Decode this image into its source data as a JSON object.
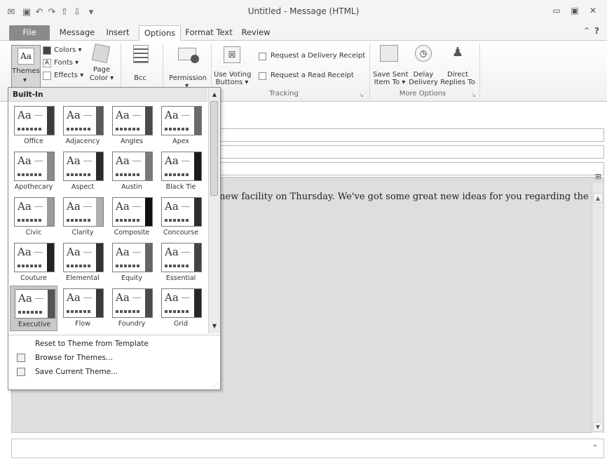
{
  "window": {
    "title": "Untitled - Message (HTML)"
  },
  "tabs": [
    {
      "label": "File"
    },
    {
      "label": "Message"
    },
    {
      "label": "Insert"
    },
    {
      "label": "Options"
    },
    {
      "label": "Format Text"
    },
    {
      "label": "Review"
    }
  ],
  "ribbon": {
    "themes": {
      "label": "Themes"
    },
    "colors": {
      "label": "Colors ▾"
    },
    "fonts": {
      "label": "Fonts ▾"
    },
    "effects": {
      "label": "Effects ▾"
    },
    "page_color": {
      "line1": "Page",
      "line2": "Color ▾"
    },
    "bcc": {
      "label": "Bcc"
    },
    "permission": {
      "label": "Permission"
    },
    "use_voting": {
      "line1": "Use Voting",
      "line2": "Buttons ▾"
    },
    "delivery_receipt": {
      "label": "Request a Delivery Receipt"
    },
    "read_receipt": {
      "label": "Request a Read Receipt"
    },
    "tracking_group": {
      "label": "Tracking"
    },
    "save_sent": {
      "line1": "Save Sent",
      "line2": "Item To ▾"
    },
    "delay_delivery": {
      "line1": "Delay",
      "line2": "Delivery"
    },
    "direct_replies": {
      "line1": "Direct",
      "line2": "Replies To"
    },
    "more_options_group": {
      "label": "More Options"
    }
  },
  "gallery": {
    "header": "Built-In",
    "themes": [
      {
        "name": "Office",
        "side": "#3c3c3c"
      },
      {
        "name": "Adjacency",
        "side": "#5a5a5a"
      },
      {
        "name": "Angles",
        "side": "#4a4a4a"
      },
      {
        "name": "Apex",
        "side": "#6a6a6a"
      },
      {
        "name": "Apothecary",
        "side": "#8a8a8a"
      },
      {
        "name": "Aspect",
        "side": "#2a2a2a"
      },
      {
        "name": "Austin",
        "side": "#7a7a7a"
      },
      {
        "name": "Black Tie",
        "side": "#1a1a1a"
      },
      {
        "name": "Civic",
        "side": "#9a9a9a"
      },
      {
        "name": "Clarity",
        "side": "#b0b0b0"
      },
      {
        "name": "Composite",
        "side": "#111111"
      },
      {
        "name": "Concourse",
        "side": "#2c2c2c"
      },
      {
        "name": "Couture",
        "side": "#222222"
      },
      {
        "name": "Elemental",
        "side": "#333333"
      },
      {
        "name": "Equity",
        "side": "#666666"
      },
      {
        "name": "Essential",
        "side": "#444444"
      },
      {
        "name": "Executive",
        "side": "#555555"
      },
      {
        "name": "Flow",
        "side": "#3a3a3a"
      },
      {
        "name": "Foundry",
        "side": "#4c4c4c"
      },
      {
        "name": "Grid",
        "side": "#262626"
      }
    ],
    "commands": [
      {
        "label": "Reset to Theme from Template"
      },
      {
        "label": "Browse for Themes..."
      },
      {
        "label": "Save Current Theme..."
      }
    ]
  },
  "message": {
    "body_text": "new facility on Thursday. We've got some great new ideas for you regarding the"
  }
}
